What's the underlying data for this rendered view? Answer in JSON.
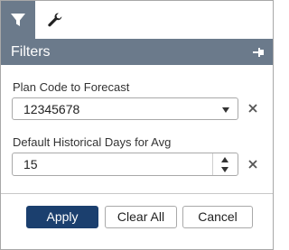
{
  "tabs": [
    {
      "icon": "filter-icon",
      "active": true
    },
    {
      "icon": "wrench-icon",
      "active": false
    }
  ],
  "header": {
    "title": "Filters",
    "pin_icon": "pin-icon",
    "color": "#6b7a8b"
  },
  "fields": {
    "plan_code": {
      "label": "Plan Code to Forecast",
      "value": "12345678"
    },
    "historical_days": {
      "label": "Default Historical Days for Avg",
      "value": "15"
    }
  },
  "buttons": {
    "apply": "Apply",
    "clear_all": "Clear All",
    "cancel": "Cancel"
  },
  "colors": {
    "primary": "#1b3f6e",
    "header": "#6b7a8b"
  }
}
